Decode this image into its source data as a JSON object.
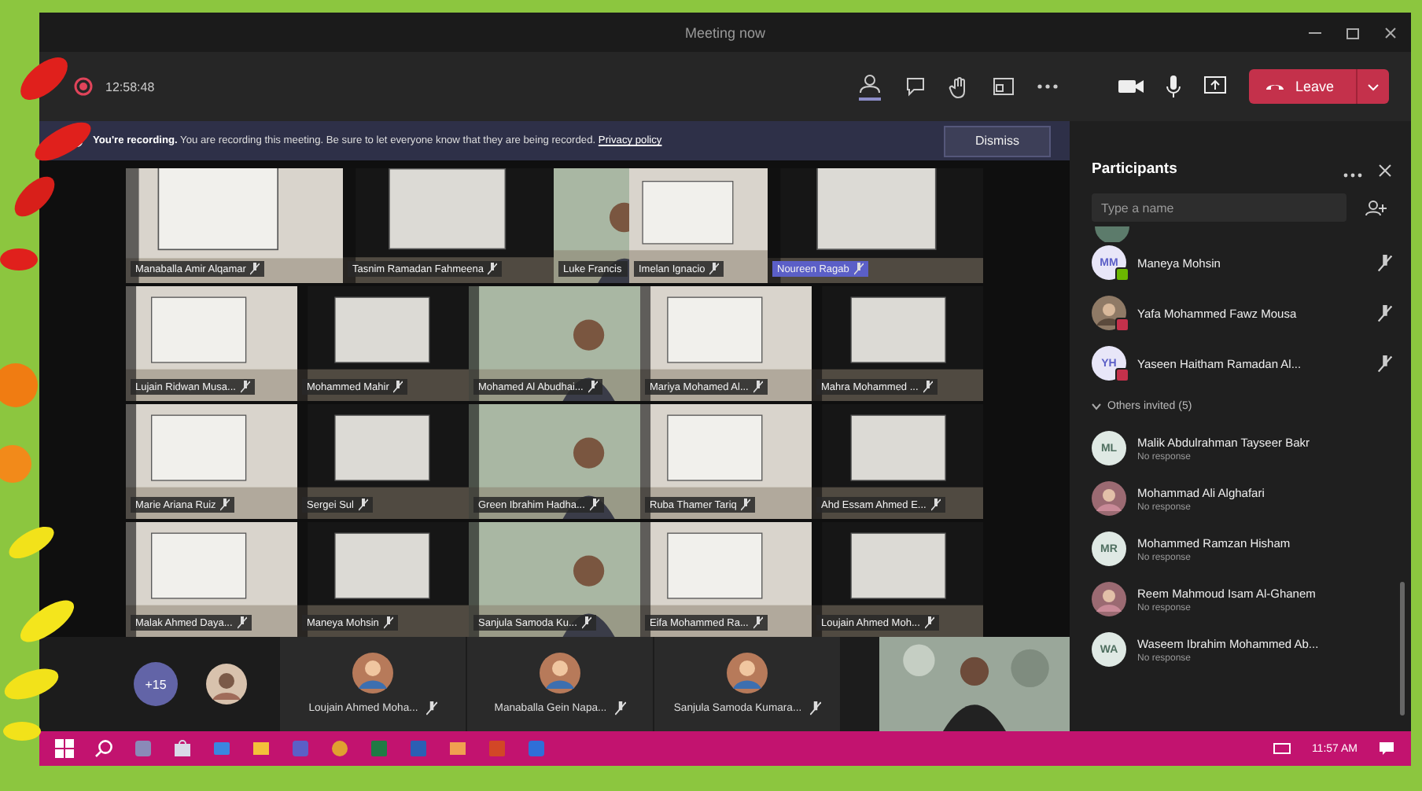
{
  "window": {
    "title": "Meeting now"
  },
  "toolbar": {
    "timer": "12:58:48",
    "leave_label": "Leave"
  },
  "recording_banner": {
    "title": "You're recording.",
    "message": "You are recording this meeting. Be sure to let everyone know that they are being recorded.",
    "link": "Privacy policy",
    "button": "Dismiss"
  },
  "video_grid": {
    "rows": [
      [
        {
          "name": "Manaballa Amir Alqamar",
          "highlighted": false
        },
        {
          "name": "Tasnim Ramadan Fahmeena",
          "highlighted": false
        },
        {
          "name": "Luke Francis",
          "highlighted": false
        },
        {
          "name": "Imelan Ignacio",
          "highlighted": false
        },
        {
          "name": "Noureen Ragab",
          "highlighted": true
        }
      ],
      [
        {
          "name": "Lujain Ridwan Musa...",
          "highlighted": false
        },
        {
          "name": "Mohammed Mahir",
          "highlighted": false
        },
        {
          "name": "Mohamed Al Abudhai...",
          "highlighted": false
        },
        {
          "name": "Mariya Mohamed Al...",
          "highlighted": false
        },
        {
          "name": "Mahra Mohammed ...",
          "highlighted": false
        }
      ],
      [
        {
          "name": "Marie Ariana Ruiz",
          "highlighted": false
        },
        {
          "name": "Sergei Sul",
          "highlighted": false
        },
        {
          "name": "Green Ibrahim Hadha...",
          "highlighted": false
        },
        {
          "name": "Ruba Thamer Tariq",
          "highlighted": false
        },
        {
          "name": "Ahd Essam Ahmed E...",
          "highlighted": false
        }
      ],
      [
        {
          "name": "Malak Ahmed Daya...",
          "highlighted": false
        },
        {
          "name": "Maneya Mohsin",
          "highlighted": false
        },
        {
          "name": "Sanjula Samoda Ku...",
          "highlighted": false
        },
        {
          "name": "Eifa Mohammed Ra...",
          "highlighted": false
        },
        {
          "name": "Loujain Ahmed Moh...",
          "highlighted": false
        }
      ]
    ]
  },
  "bottom_strip": {
    "overflow_count": "+15",
    "participants": [
      {
        "name": "Loujain Ahmed Moha..."
      },
      {
        "name": "Manaballa Gein Napa..."
      },
      {
        "name": "Sanjula Samoda Kumara..."
      }
    ]
  },
  "participants_panel": {
    "title": "Participants",
    "search": {
      "placeholder": "Type a name"
    },
    "in_meeting": [
      {
        "name": "Maneya Mohsin",
        "kind": "initials",
        "initials": "MM",
        "color": "#6bb700"
      },
      {
        "name": "Yafa Mohammed Fawz Mousa",
        "color": "#c4314b"
      },
      {
        "name": "Yaseen Haitham Ramadan Al...",
        "kind": "initials",
        "initials": "YH",
        "color": "#c4314b"
      }
    ],
    "invited_section": "Others invited (5)",
    "invited": [
      {
        "name": "Malik Abdulrahman Tayseer Bakr",
        "status": "No response",
        "kind": "initials",
        "initials": "ML"
      },
      {
        "name": "Mohammad Ali Alghafari",
        "status": "No response"
      },
      {
        "name": "Mohammed Ramzan Hisham",
        "status": "No response",
        "kind": "initials",
        "initials": "MR"
      },
      {
        "name": "Reem Mahmoud Isam Al-Ghanem",
        "status": "No response"
      },
      {
        "name": "Waseem Ibrahim Mohammed Ab...",
        "status": "No response",
        "kind": "initials",
        "initials": "WA"
      }
    ]
  },
  "taskbar": {
    "clock": "11:57 AM"
  }
}
